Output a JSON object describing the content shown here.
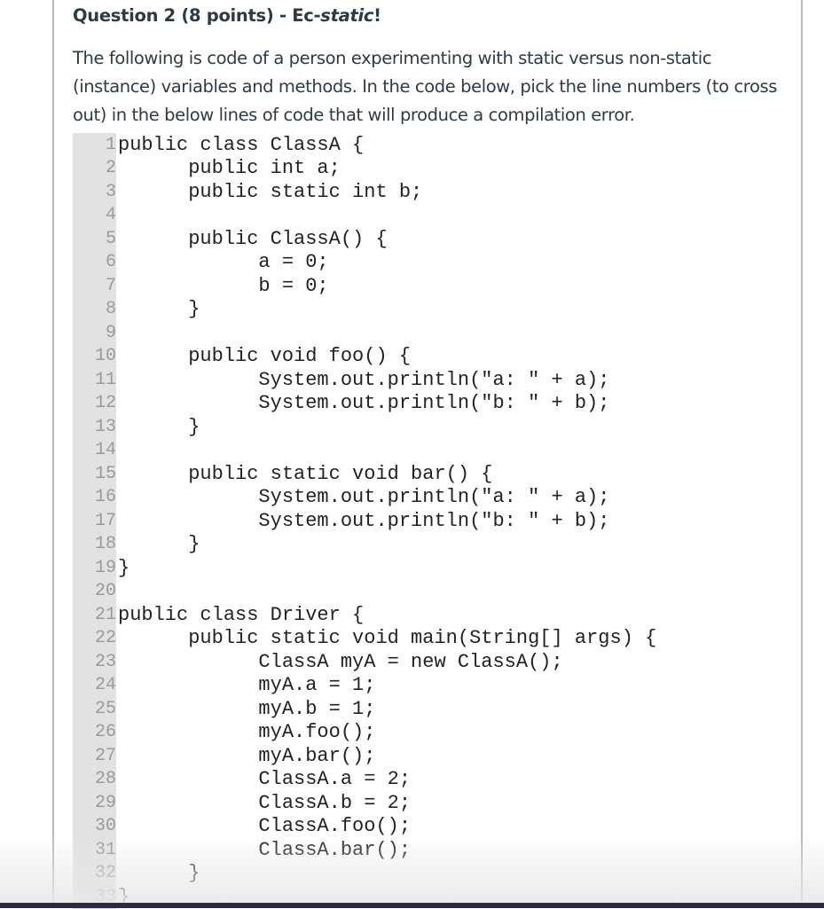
{
  "question": {
    "title_prefix": "Question 2 (8 points) - Ec-",
    "title_emphasis": "static",
    "title_suffix": "!",
    "prompt_lines": [
      "The following is code of a person experimenting with static versus non-static",
      "(instance) variables and methods. In the code below, pick the line numbers (to cross",
      "out) in the below lines of code that will produce a compilation error."
    ]
  },
  "code": {
    "lines": [
      {
        "n": "1",
        "text": "public class ClassA {"
      },
      {
        "n": "2",
        "text": "      public int a;"
      },
      {
        "n": "3",
        "text": "      public static int b;"
      },
      {
        "n": "4",
        "text": ""
      },
      {
        "n": "5",
        "text": "      public ClassA() {"
      },
      {
        "n": "6",
        "text": "            a = 0;"
      },
      {
        "n": "7",
        "text": "            b = 0;"
      },
      {
        "n": "8",
        "text": "      }"
      },
      {
        "n": "9",
        "text": ""
      },
      {
        "n": "10",
        "text": "      public void foo() {"
      },
      {
        "n": "11",
        "text": "            System.out.println(\"a: \" + a);"
      },
      {
        "n": "12",
        "text": "            System.out.println(\"b: \" + b);"
      },
      {
        "n": "13",
        "text": "      }"
      },
      {
        "n": "14",
        "text": ""
      },
      {
        "n": "15",
        "text": "      public static void bar() {"
      },
      {
        "n": "16",
        "text": "            System.out.println(\"a: \" + a);"
      },
      {
        "n": "17",
        "text": "            System.out.println(\"b: \" + b);"
      },
      {
        "n": "18",
        "text": "      }"
      },
      {
        "n": "19",
        "text": "}"
      },
      {
        "n": "20",
        "text": ""
      },
      {
        "n": "21",
        "text": "public class Driver {"
      },
      {
        "n": "22",
        "text": "      public static void main(String[] args) {"
      },
      {
        "n": "23",
        "text": "            ClassA myA = new ClassA();"
      },
      {
        "n": "24",
        "text": "            myA.a = 1;"
      },
      {
        "n": "25",
        "text": "            myA.b = 1;"
      },
      {
        "n": "26",
        "text": "            myA.foo();"
      },
      {
        "n": "27",
        "text": "            myA.bar();"
      },
      {
        "n": "28",
        "text": "            ClassA.a = 2;"
      },
      {
        "n": "29",
        "text": "            ClassA.b = 2;"
      },
      {
        "n": "30",
        "text": "            ClassA.foo();"
      },
      {
        "n": "31",
        "text": "            ClassA.bar();"
      },
      {
        "n": "32",
        "text": "      }"
      },
      {
        "n": "33",
        "text": "}"
      }
    ]
  }
}
